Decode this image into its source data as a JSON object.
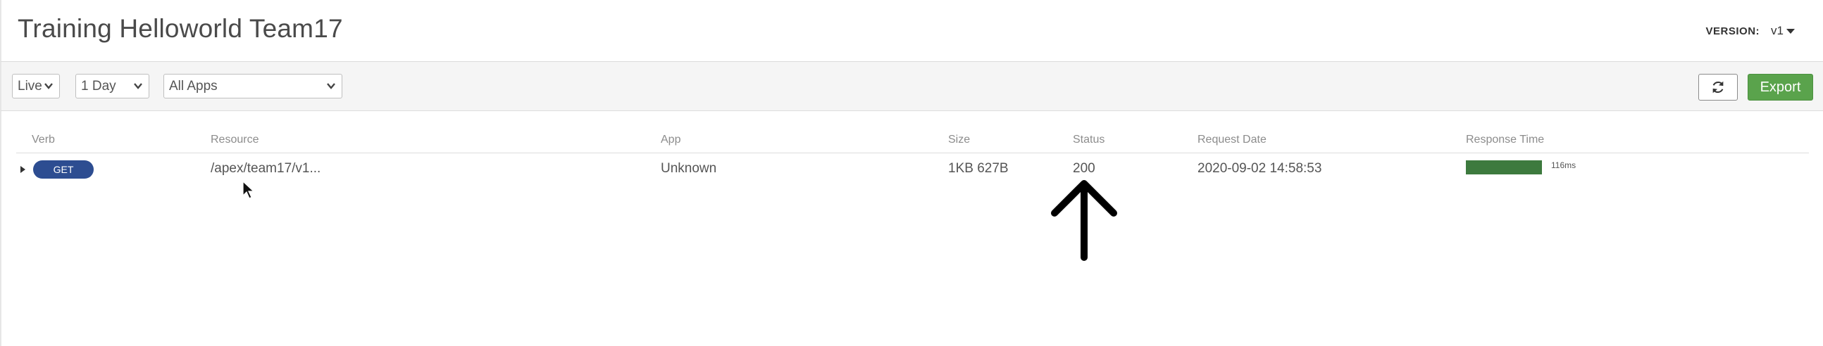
{
  "header": {
    "title": "Training Helloworld Team17",
    "version_label": "VERSION:",
    "version_value": "v1"
  },
  "toolbar": {
    "mode_select": "Live",
    "range_select": "1 Day",
    "apps_select": "All Apps",
    "refresh_icon": "refresh-icon",
    "export_label": "Export"
  },
  "table": {
    "columns": [
      "Verb",
      "Resource",
      "App",
      "Size",
      "Status",
      "Request Date",
      "Response Time"
    ],
    "rows": [
      {
        "verb": "GET",
        "resource": "/apex/team17/v1...",
        "app": "Unknown",
        "size": "1KB 627B",
        "status": "200",
        "request_date": "2020-09-02 14:58:53",
        "response_time": "116ms"
      }
    ]
  },
  "colors": {
    "verb_pill": "#2d4d91",
    "export_button": "#5aa34c",
    "response_bar": "#3d7a3e"
  }
}
